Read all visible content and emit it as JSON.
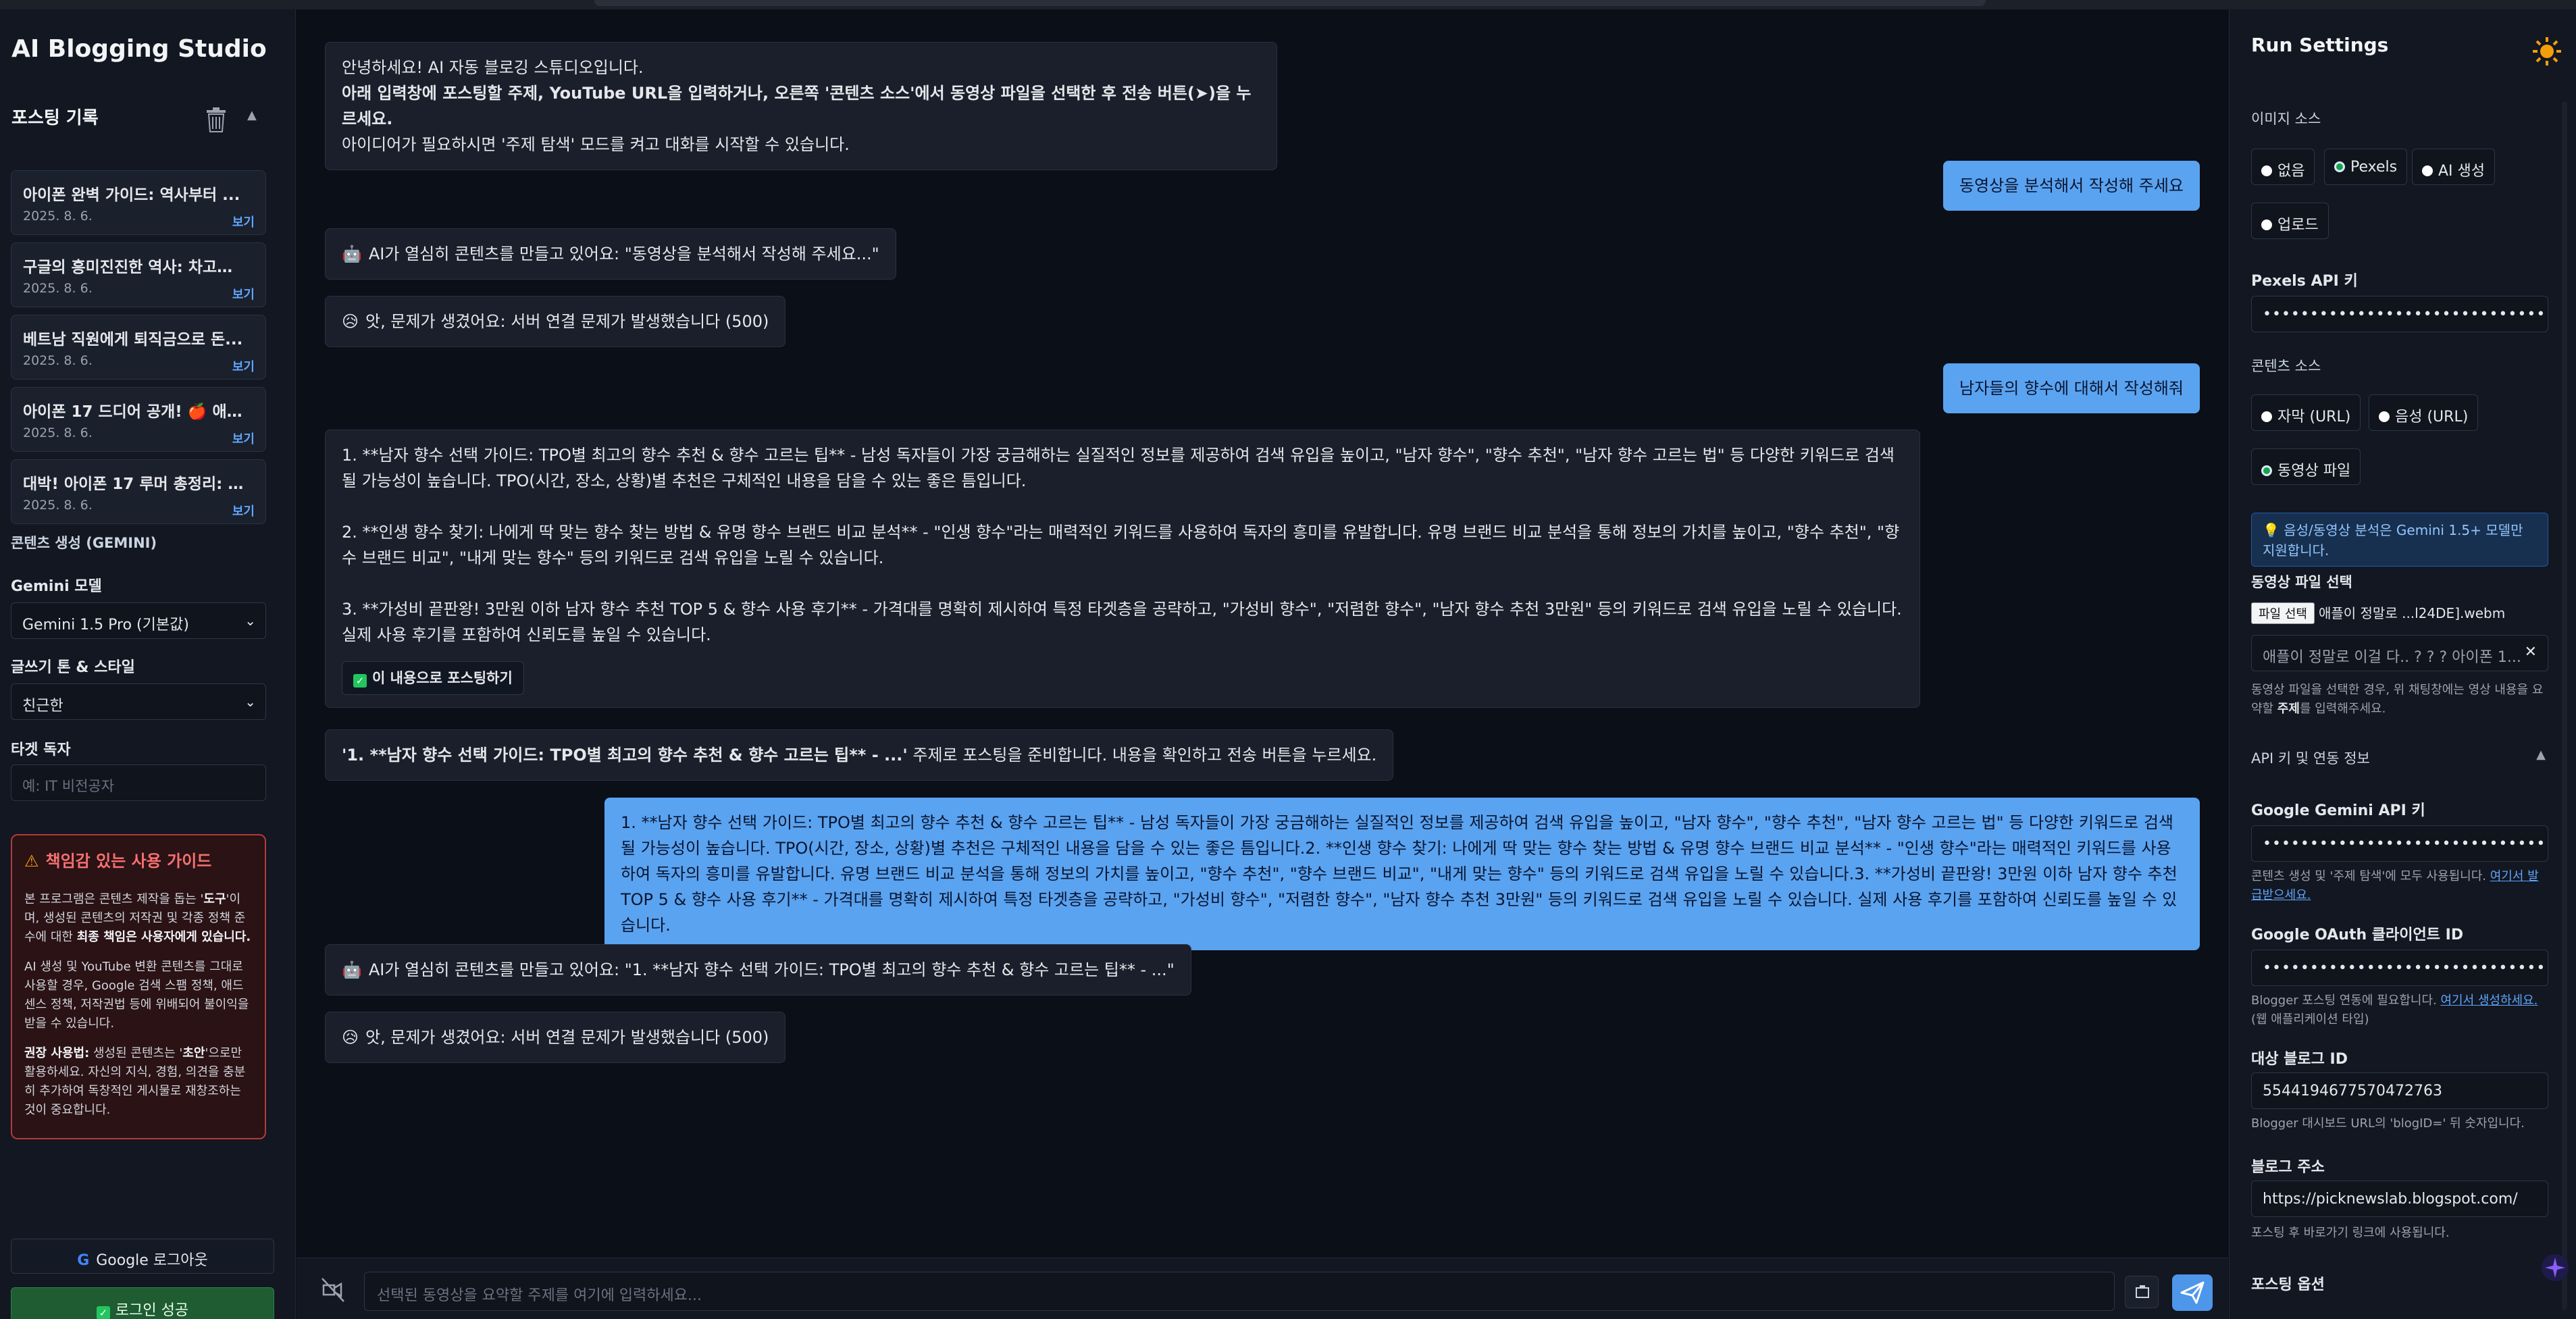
{
  "sidebar": {
    "app_title": "AI Blogging Studio",
    "history_title": "포스팅 기록",
    "history": [
      {
        "title": "아이폰 완벽 가이드: 역사부터 ...",
        "date": "2025. 8. 6.",
        "view": "보기"
      },
      {
        "title": "구글의 흥미진진한 역사: 차고에...",
        "date": "2025. 8. 6.",
        "view": "보기"
      },
      {
        "title": "베트남 직원에게 퇴직금으로 돈...",
        "date": "2025. 8. 6.",
        "view": "보기"
      },
      {
        "title": "아이폰 17 드디어 공개! 🍎 애플...",
        "date": "2025. 8. 6.",
        "view": "보기"
      },
      {
        "title": "대박! 아이폰 17 루머 총정리: 애...",
        "date": "2025. 8. 6.",
        "view": "보기"
      }
    ],
    "content_gen_title": "콘텐츠 생성 (GEMINI)",
    "model_label": "Gemini 모델",
    "model_value": "Gemini 1.5 Pro (기본값)",
    "tone_label": "글쓰기 톤 & 스타일",
    "tone_value": "친근한",
    "target_label": "타겟 독자",
    "target_placeholder": "예: IT 비전공자",
    "guide": {
      "title": "책임감 있는 사용 가이드",
      "p1_a": "본 프로그램은 콘텐츠 제작을 돕는 '",
      "p1_b": "도구",
      "p1_c": "'이며, 생성된 콘텐츠의 저작권 및 각종 정책 준수에 대한 ",
      "p1_d": "최종 책임은 사용자에게 있습니다.",
      "p2": "AI 생성 및 YouTube 변환 콘텐츠를 그대로 사용할 경우, Google 검색 스팸 정책, 애드센스 정책, 저작권법 등에 위배되어 불이익을 받을 수 있습니다.",
      "p3_a": "권장 사용법:",
      "p3_b": " 생성된 콘텐츠는 '",
      "p3_c": "초안",
      "p3_d": "'으로만 활용하세요. 자신의 지식, 경험, 의견을 충분히 추가하여 독창적인 게시물로 재창조하는 것이 중요합니다."
    },
    "logout_label": "Google 로그아웃",
    "login_status": "로그인 성공"
  },
  "chat": {
    "welcome_line1": "안녕하세요! AI 자동 블로깅 스튜디오입니다.",
    "welcome_line2": "아래 입력창에 포스팅할 주제, YouTube URL을 입력하거나, 오른쪽 '콘텐츠 소스'에서 동영상 파일을 선택한 후 전송 버튼(➤)을 누르세요.",
    "welcome_line3": "아이디어가 필요하시면 '주제 탐색' 모드를 켜고 대화를 시작할 수 있습니다.",
    "user1": "동영상을 분석해서 작성해 주세요",
    "ai_working1": "AI가 열심히 콘텐츠를 만들고 있어요: \"동영상을 분석해서 작성해 주세요...\"",
    "error1": "앗, 문제가 생겼어요: 서버 연결 문제가 발생했습니다 (500)",
    "user2": "남자들의 향수에 대해서 작성해줘",
    "topics_p1": "1. **남자 향수 선택 가이드: TPO별 최고의 향수 추천 & 향수 고르는 팁** - 남성 독자들이 가장 궁금해하는 실질적인 정보를 제공하여 검색 유입을 높이고, \"남자 향수\", \"향수 추천\", \"남자 향수 고르는 법\" 등 다양한 키워드로 검색될 가능성이 높습니다. TPO(시간, 장소, 상황)별 추천은 구체적인 내용을 담을 수 있는 좋은 틈입니다.",
    "topics_p2": "2. **인생 향수 찾기: 나에게 딱 맞는 향수 찾는 방법 & 유명 향수 브랜드 비교 분석** - \"인생 향수\"라는 매력적인 키워드를 사용하여 독자의 흥미를 유발합니다. 유명 브랜드 비교 분석을 통해 정보의 가치를 높이고, \"향수 추천\", \"향수 브랜드 비교\", \"내게 맞는 향수\" 등의 키워드로 검색 유입을 노릴 수 있습니다.",
    "topics_p3": "3. **가성비 끝판왕! 3만원 이하 남자 향수 추천 TOP 5 & 향수 사용 후기** - 가격대를 명확히 제시하여 특정 타겟층을 공략하고, \"가성비 향수\", \"저렴한 향수\", \"남자 향수 추천 3만원\" 등의 키워드로 검색 유입을 노릴 수 있습니다. 실제 사용 후기를 포함하여 신뢰도를 높일 수 있습니다.",
    "post_this_label": "이 내용으로 포스팅하기",
    "prep_bold": "'1. **남자 향수 선택 가이드: TPO별 최고의 향수 추천 & 향수 고르는 팁** - ...'",
    "prep_rest": " 주제로 포스팅을 준비합니다. 내용을 확인하고 전송 버튼을 누르세요.",
    "user3": "1. **남자 향수 선택 가이드: TPO별 최고의 향수 추천 & 향수 고르는 팁** - 남성 독자들이 가장 궁금해하는 실질적인 정보를 제공하여 검색 유입을 높이고, \"남자 향수\", \"향수 추천\", \"남자 향수 고르는 법\" 등 다양한 키워드로 검색될 가능성이 높습니다. TPO(시간, 장소, 상황)별 추천은 구체적인 내용을 담을 수 있는 좋은 틈입니다.2. **인생 향수 찾기: 나에게 딱 맞는 향수 찾는 방법 & 유명 향수 브랜드 비교 분석** - \"인생 향수\"라는 매력적인 키워드를 사용하여 독자의 흥미를 유발합니다. 유명 브랜드 비교 분석을 통해 정보의 가치를 높이고, \"향수 추천\", \"향수 브랜드 비교\", \"내게 맞는 향수\" 등의 키워드로 검색 유입을 노릴 수 있습니다.3. **가성비 끝판왕! 3만원 이하 남자 향수 추천 TOP 5 & 향수 사용 후기** - 가격대를 명확히 제시하여 특정 타겟층을 공략하고, \"가성비 향수\", \"저렴한 향수\", \"남자 향수 추천 3만원\" 등의 키워드로 검색 유입을 노릴 수 있습니다. 실제 사용 후기를 포함하여 신뢰도를 높일 수 있습니다.",
    "ai_working2": "AI가 열심히 콘텐츠를 만들고 있어요: \"1. **남자 향수 선택 가이드: TPO별 최고의 향수 추천 & 향수 고르는 팁** - ...\"",
    "error2": "앗, 문제가 생겼어요: 서버 연결 문제가 발생했습니다 (500)",
    "input_placeholder": "선택된 동영상을 요약할 주제를 여기에 입력하세요..."
  },
  "settings": {
    "title": "Run Settings",
    "image_source_label": "이미지 소스",
    "image_options": [
      "없음",
      "Pexels",
      "AI 생성",
      "업로드"
    ],
    "image_selected": "Pexels",
    "pexels_label": "Pexels API 키",
    "pexels_value": "••••••••••••••••••••••••••••••••••••••••••••••",
    "content_source_label": "콘텐츠 소스",
    "content_options": [
      "자막 (URL)",
      "음성 (URL)",
      "동영상 파일"
    ],
    "content_selected": "동영상 파일",
    "info_note": "💡 음성/동영상 분석은 Gemini 1.5+ 모델만 지원합니다.",
    "video_label": "동영상 파일 선택",
    "file_button": "파일 선택",
    "file_name": "애플이 정말로 ...l24DE].webm",
    "video_chip": "애플이 정말로 이걸 다.. ? ? ?  아이폰 1...",
    "video_note_a": "동영상 파일을 선택한 경우, 위 채팅창에는 영상 내용을 요약할 ",
    "video_note_b": "주제",
    "video_note_c": "를 입력해주세요.",
    "api_section": "API 키 및 연동 정보",
    "gemini_label": "Google Gemini API 키",
    "gemini_value": "••••••••••••••••••••••••••••••••••••••••••••••",
    "gemini_note": "콘텐츠 생성 및 '주제 탐색'에 모두 사용됩니다. ",
    "gemini_link": "여기서 발급받으세요.",
    "oauth_label": "Google OAuth 클라이언트 ID",
    "oauth_value": "••••••••••••••••••••••••••••••••••••••••••••••",
    "oauth_note_a": "Blogger 포스팅 연동에 필요합니다. ",
    "oauth_link": "여기서 생성하세요.",
    "oauth_note_b": " (웹 애플리케이션 타입)",
    "blog_id_label": "대상 블로그 ID",
    "blog_id_value": "5544194677570472763",
    "blog_id_note": "Blogger 대시보드 URL의 'blogID=' 뒤 숫자입니다.",
    "blog_url_label": "블로그 주소",
    "blog_url_value": "https://picknewslab.blogspot.com/",
    "blog_url_note": "포스팅 후 바로가기 링크에 사용됩니다.",
    "posting_options_label": "포스팅 옵션"
  },
  "colors": {
    "accent": "#5aa3f0",
    "danger": "#b43a3a",
    "success": "#1f5c32"
  }
}
